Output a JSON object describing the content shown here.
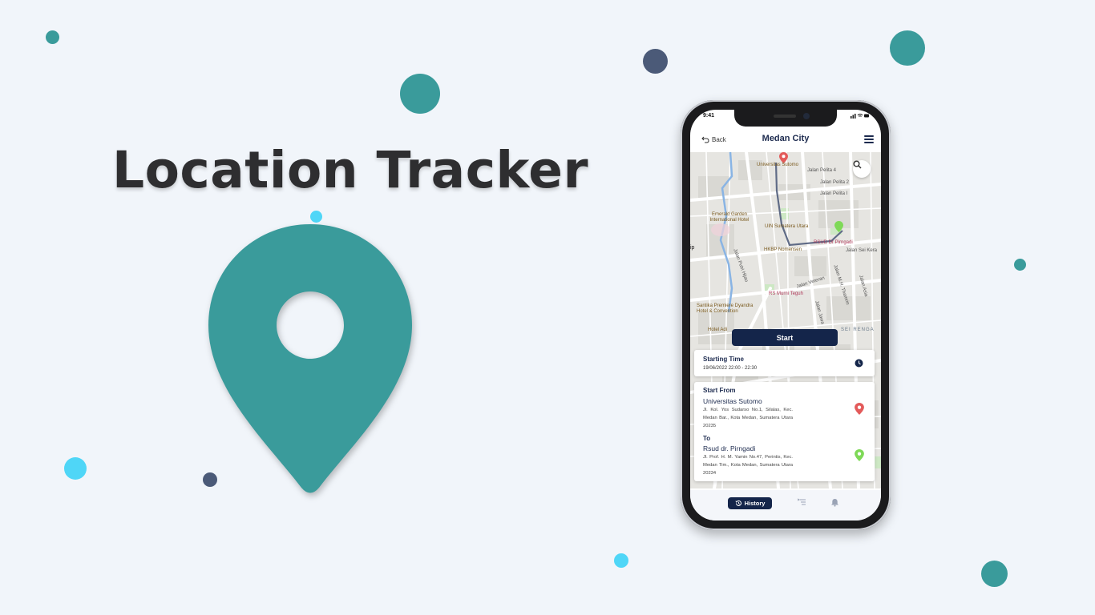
{
  "hero": {
    "title": "Location Tracker"
  },
  "colors": {
    "accent": "#3a9b9b",
    "navy": "#14254a",
    "red_pin": "#e35a5a",
    "green_pin": "#7ed957",
    "cyan": "#4fd6f7",
    "slate": "#4b5a78"
  },
  "phone": {
    "status_time": "9:41",
    "status_icons": "signal-wifi-battery",
    "app_bar": {
      "back_label": "Back",
      "title": "Medan City",
      "menu_icon": "hamburger-icon"
    },
    "map": {
      "labels": [
        "Universitas Sutomo",
        "Jalan Pelita 4",
        "Jalan Pelita 2",
        "Jalan Pelita I",
        "Emerald Garden International Hotel",
        "UIN Sumatera Utara",
        "RSUD Dr Pirngadi",
        "HKBP Nomensen",
        "Jalan Sei Kera",
        "Jalan Putri Hijau",
        "Jalan Veteran",
        "RS Murni Teguh",
        "Jalan M.H. Thamrin",
        "Jalan Asia",
        "Santika Premiere Dyandra Hotel & Convention",
        "Hotel Adi",
        "Jalan Jawa",
        "SEI RENGA",
        "ip"
      ],
      "search_icon": "search-icon"
    },
    "start_button": "Start",
    "starting_time": {
      "title": "Starting Time",
      "value": "19/06/2022 22:00 - 22:30",
      "icon": "clock-icon"
    },
    "route": {
      "from_title": "Start From",
      "from_name": "Universitas Sutomo",
      "from_address": "Jl. Kol. Yos Sudarso No.1, Silalas, Kec. Medan Bar., Kota Medan, Sumatera Utara 20235",
      "to_title": "To",
      "to_name": "Rsud dr. Pirngadi",
      "to_address": "Jl. Prof. H. M. Yamin No.47, Perintis, Kec. Medan Tim., Kota Medan, Sumatera Utara 20234"
    },
    "bottom_nav": {
      "history_label": "History",
      "list_icon": "list-icon",
      "bell_icon": "bell-icon"
    }
  }
}
